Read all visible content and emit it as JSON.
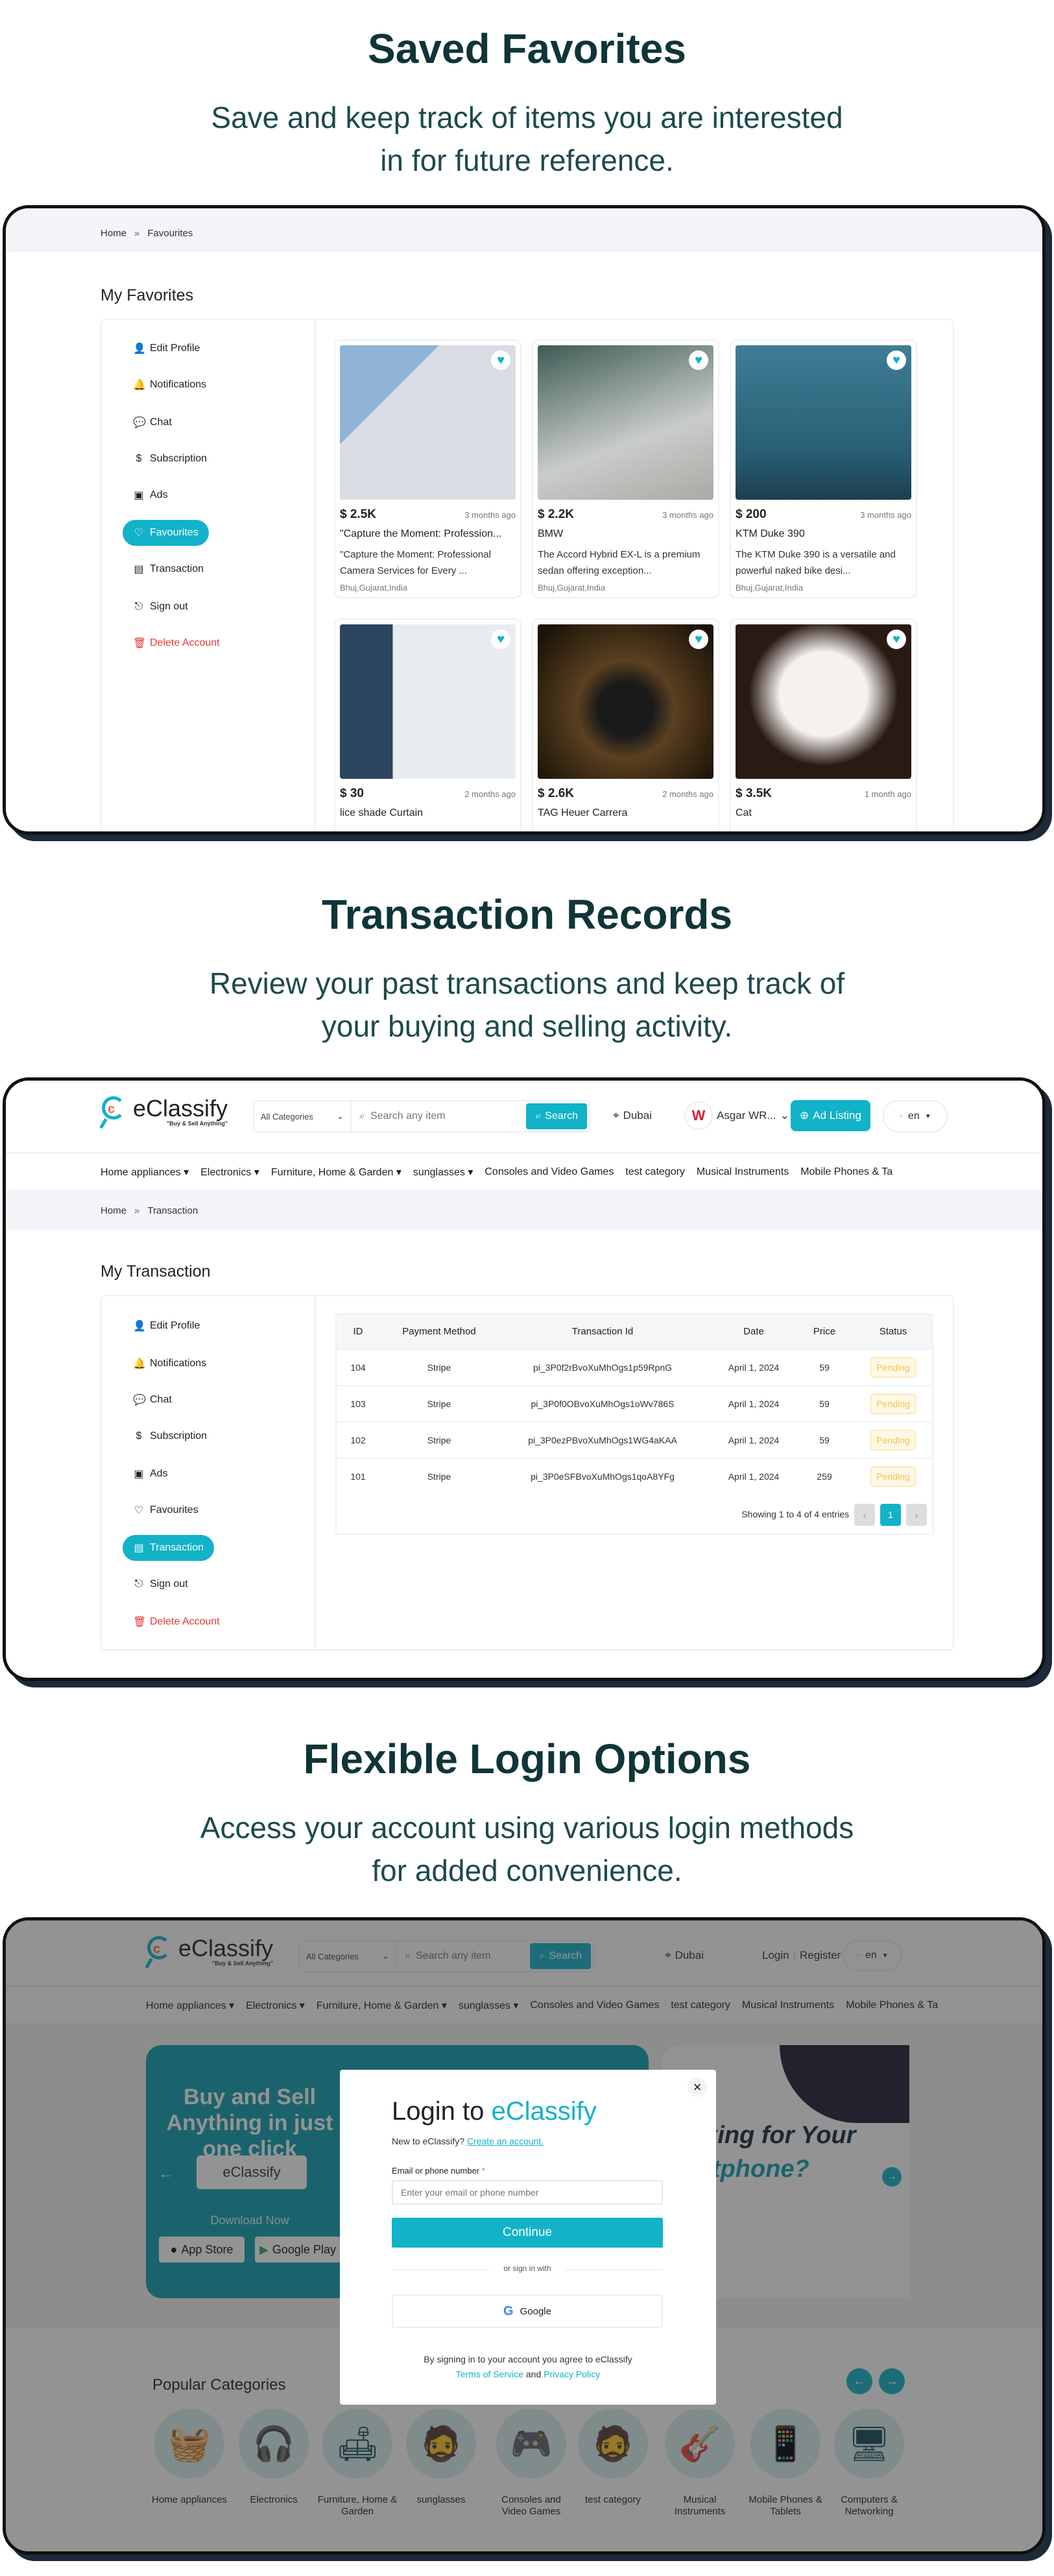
{
  "colors": {
    "accent": "#12b2c8",
    "heading": "#0f3538",
    "danger": "#e53935",
    "pending": "#f6c04a"
  },
  "section1": {
    "title": "Saved Favorites",
    "subtitle_lines": [
      "Save and keep track of items you are interested",
      "in for future reference."
    ]
  },
  "favorites": {
    "breadcrumb": {
      "home": "Home",
      "sep": "»",
      "current": "Favourites"
    },
    "page_title": "My Favorites",
    "cards": [
      {
        "price": "$ 2.5K",
        "time": "3 months ago",
        "title": "\"Capture the Moment: Profession...",
        "desc": "\"Capture the Moment: Professional Camera Services for Every ...",
        "location": "Bhuj,Gujarat,India",
        "image": "security-camera"
      },
      {
        "price": "$ 2.2K",
        "time": "3 months ago",
        "title": "BMW",
        "desc": "The Accord Hybrid EX-L is a premium sedan offering exception...",
        "location": "Bhuj,Gujarat,India",
        "image": "white-car"
      },
      {
        "price": "$ 200",
        "time": "3 months ago",
        "title": "KTM Duke 390",
        "desc": "The KTM Duke 390 is a versatile and powerful naked bike desi...",
        "location": "Bhuj,Gujarat,India",
        "image": "motorcycle"
      },
      {
        "price": "$ 30",
        "time": "2 months ago",
        "title": "lice shade Curtain",
        "desc": "",
        "location": "",
        "image": "living-room"
      },
      {
        "price": "$ 2.6K",
        "time": "2 months ago",
        "title": "TAG Heuer Carrera",
        "desc": "",
        "location": "",
        "image": "watch"
      },
      {
        "price": "$ 3.5K",
        "time": "1 month ago",
        "title": "Cat",
        "desc": "",
        "location": "",
        "image": "kitten"
      }
    ]
  },
  "sidebar": [
    {
      "label": "Edit Profile",
      "icon": "user-icon"
    },
    {
      "label": "Notifications",
      "icon": "bell-icon"
    },
    {
      "label": "Chat",
      "icon": "chat-icon"
    },
    {
      "label": "Subscription",
      "icon": "dollar-icon"
    },
    {
      "label": "Ads",
      "icon": "ad-icon"
    },
    {
      "label": "Favourites",
      "icon": "heart-icon"
    },
    {
      "label": "Transaction",
      "icon": "receipt-icon"
    },
    {
      "label": "Sign out",
      "icon": "sign-out-icon"
    },
    {
      "label": "Delete Account",
      "icon": "trash-icon"
    }
  ],
  "section2": {
    "title": "Transaction Records",
    "subtitle_lines": [
      "Review your past transactions and keep track of",
      "your buying and selling activity."
    ]
  },
  "header": {
    "logo_name": "eClassify",
    "logo_tagline": "\"Buy & Sell Anything\"",
    "category_select": "All Categories",
    "search_placeholder": "Search any item",
    "search_button": "Search",
    "location": "Dubai",
    "user_name": "Asgar WR...",
    "avatar_text": "W",
    "ad_listing": "Ad Listing",
    "language": "en",
    "login": "Login",
    "register": "Register"
  },
  "nav": [
    "Home appliances ▾",
    "Electronics ▾",
    "Furniture, Home & Garden ▾",
    "sunglasses ▾",
    "Consoles and Video Games",
    "test category",
    "Musical Instruments",
    "Mobile Phones & Ta"
  ],
  "transactions": {
    "breadcrumb": {
      "home": "Home",
      "sep": "»",
      "current": "Transaction"
    },
    "page_title": "My Transaction",
    "columns": [
      "ID",
      "Payment Method",
      "Transaction Id",
      "Date",
      "Price",
      "Status"
    ],
    "rows": [
      [
        "104",
        "Stripe",
        "pi_3P0f2rBvoXuMhOgs1p59RpnG",
        "April 1, 2024",
        "59",
        "Pending"
      ],
      [
        "103",
        "Stripe",
        "pi_3P0f0OBvoXuMhOgs1oWv786S",
        "April 1, 2024",
        "59",
        "Pending"
      ],
      [
        "102",
        "Stripe",
        "pi_3P0ezPBvoXuMhOgs1WG4aKAA",
        "April 1, 2024",
        "59",
        "Pending"
      ],
      [
        "101",
        "Stripe",
        "pi_3P0eSFBvoXuMhOgs1qoA8YFg",
        "April 1, 2024",
        "259",
        "Pending"
      ]
    ],
    "showing": "Showing 1 to 4 of 4 entries",
    "prev": "‹",
    "page": "1",
    "next": "›"
  },
  "section3": {
    "title": "Flexible Login Options",
    "subtitle_lines": [
      "Access your account using various login methods",
      "for added convenience."
    ]
  },
  "home": {
    "banner_title": "Buy and Sell Anything in just one click",
    "download": "Download Now",
    "app_store": "App Store",
    "google_play": "Google Play",
    "banner2_title": "oking for Your",
    "banner2_sub": "artphone?",
    "popular_title": "Popular Categories",
    "categories": [
      {
        "label": "Home appliances",
        "icon": "washing-machine-icon",
        "glyph": "🧺"
      },
      {
        "label": "Electronics",
        "icon": "headphones-icon",
        "glyph": "🎧"
      },
      {
        "label": "Furniture, Home & Garden",
        "icon": "furniture-icon",
        "glyph": "🛋"
      },
      {
        "label": "sunglasses",
        "icon": "avatar-icon",
        "glyph": "🧔"
      },
      {
        "label": "Consoles and Video Games",
        "icon": "console-icon",
        "glyph": "🎮"
      },
      {
        "label": "test category",
        "icon": "avatar-icon",
        "glyph": "🧔"
      },
      {
        "label": "Musical Instruments",
        "icon": "guitar-icon",
        "glyph": "🎸"
      },
      {
        "label": "Mobile Phones & Tablets",
        "icon": "phone-icon",
        "glyph": "📱"
      },
      {
        "label": "Computers & Networking",
        "icon": "computer-icon",
        "glyph": "🖥"
      }
    ]
  },
  "login": {
    "title_prefix": "Login to ",
    "title_brand": "eClassify",
    "new_text": "New to eClassify? ",
    "create_link": "Create an account.",
    "email_label": "Email or phone number",
    "required": "*",
    "email_placeholder": "Enter your email or phone number",
    "continue": "Continue",
    "or_text": "or sign in with",
    "google": "Google",
    "terms_prefix": "By signing in to your account you agree to eClassify",
    "terms_link": "Terms of Service",
    "and": " and ",
    "privacy_link": "Privacy Policy",
    "close": "×"
  }
}
